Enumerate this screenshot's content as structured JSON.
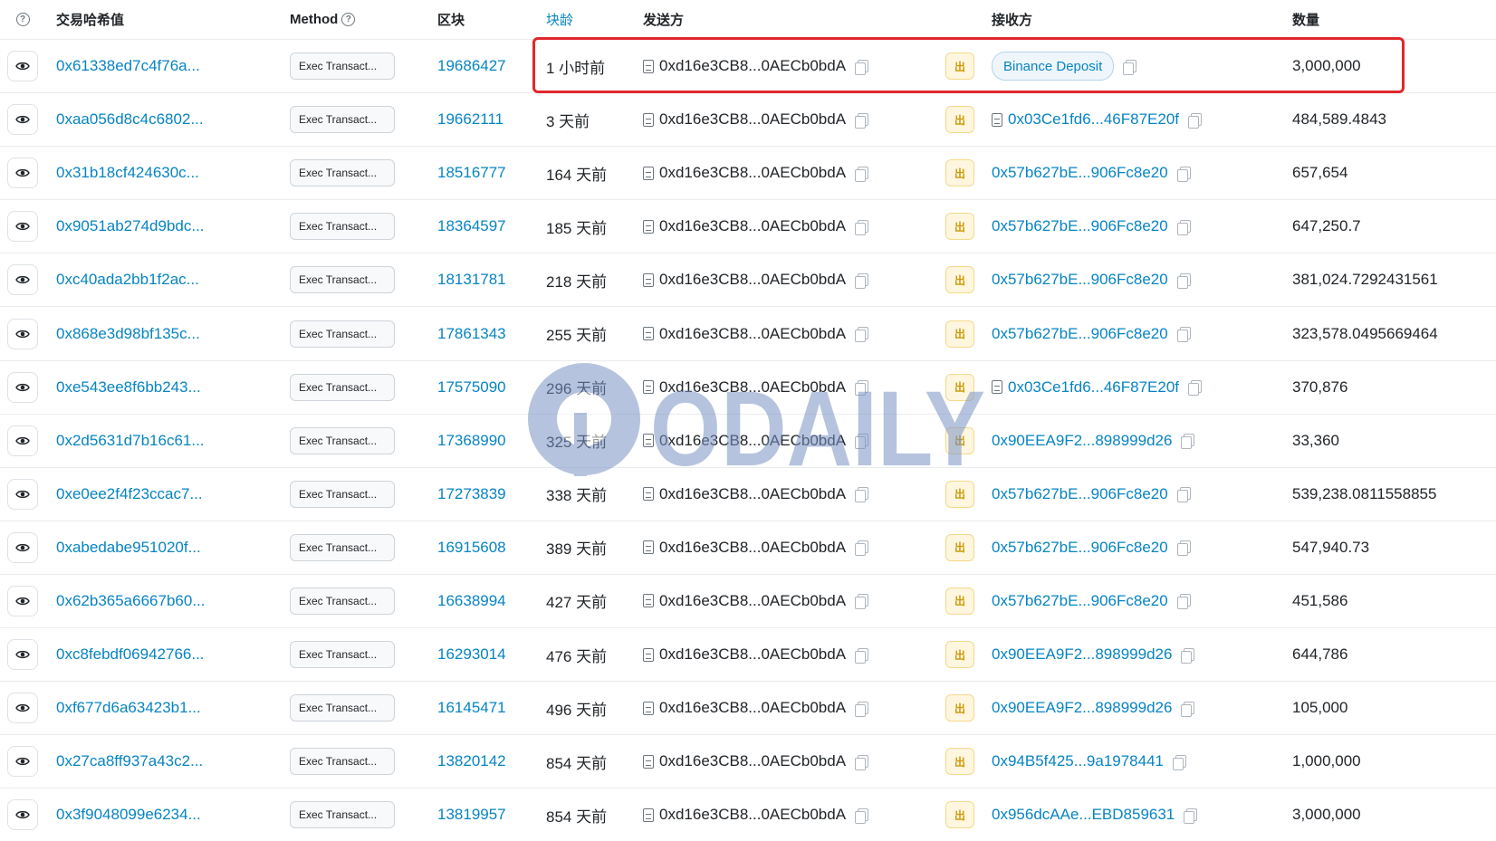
{
  "header": {
    "info_icon": "question-circle-icon",
    "tx_hash": "交易哈希值",
    "method": "Method",
    "block": "区块",
    "age": "块龄",
    "from": "发送方",
    "to": "接收方",
    "amount": "数量"
  },
  "rows": [
    {
      "hash": "0x61338ed7c4f76a...",
      "method": "Exec Transact...",
      "block": "19686427",
      "age": "1 小时前",
      "from": "0xd16e3CB8...0AECb0bdA",
      "direction": "出",
      "to": "Binance Deposit",
      "to_is_label": true,
      "amount": "3,000,000"
    },
    {
      "hash": "0xaa056d8c4c6802...",
      "method": "Exec Transact...",
      "block": "19662111",
      "age": "3 天前",
      "from": "0xd16e3CB8...0AECb0bdA",
      "direction": "出",
      "to": "0x03Ce1fd6...46F87E20f",
      "to_is_contract": true,
      "amount": "484,589.4843"
    },
    {
      "hash": "0x31b18cf424630c...",
      "method": "Exec Transact...",
      "block": "18516777",
      "age": "164 天前",
      "from": "0xd16e3CB8...0AECb0bdA",
      "direction": "出",
      "to": "0x57b627bE...906Fc8e20",
      "amount": "657,654"
    },
    {
      "hash": "0x9051ab274d9bdc...",
      "method": "Exec Transact...",
      "block": "18364597",
      "age": "185 天前",
      "from": "0xd16e3CB8...0AECb0bdA",
      "direction": "出",
      "to": "0x57b627bE...906Fc8e20",
      "amount": "647,250.7"
    },
    {
      "hash": "0xc40ada2bb1f2ac...",
      "method": "Exec Transact...",
      "block": "18131781",
      "age": "218 天前",
      "from": "0xd16e3CB8...0AECb0bdA",
      "direction": "出",
      "to": "0x57b627bE...906Fc8e20",
      "amount": "381,024.7292431561"
    },
    {
      "hash": "0x868e3d98bf135c...",
      "method": "Exec Transact...",
      "block": "17861343",
      "age": "255 天前",
      "from": "0xd16e3CB8...0AECb0bdA",
      "direction": "出",
      "to": "0x57b627bE...906Fc8e20",
      "amount": "323,578.0495669464"
    },
    {
      "hash": "0xe543ee8f6bb243...",
      "method": "Exec Transact...",
      "block": "17575090",
      "age": "296 天前",
      "from": "0xd16e3CB8...0AECb0bdA",
      "direction": "出",
      "to": "0x03Ce1fd6...46F87E20f",
      "to_is_contract": true,
      "amount": "370,876"
    },
    {
      "hash": "0x2d5631d7b16c61...",
      "method": "Exec Transact...",
      "block": "17368990",
      "age": "325 天前",
      "from": "0xd16e3CB8...0AECb0bdA",
      "direction": "出",
      "to": "0x90EEA9F2...898999d26",
      "amount": "33,360"
    },
    {
      "hash": "0xe0ee2f4f23ccac7...",
      "method": "Exec Transact...",
      "block": "17273839",
      "age": "338 天前",
      "from": "0xd16e3CB8...0AECb0bdA",
      "direction": "出",
      "to": "0x57b627bE...906Fc8e20",
      "amount": "539,238.0811558855"
    },
    {
      "hash": "0xabedabe951020f...",
      "method": "Exec Transact...",
      "block": "16915608",
      "age": "389 天前",
      "from": "0xd16e3CB8...0AECb0bdA",
      "direction": "出",
      "to": "0x57b627bE...906Fc8e20",
      "amount": "547,940.73"
    },
    {
      "hash": "0x62b365a6667b60...",
      "method": "Exec Transact...",
      "block": "16638994",
      "age": "427 天前",
      "from": "0xd16e3CB8...0AECb0bdA",
      "direction": "出",
      "to": "0x57b627bE...906Fc8e20",
      "amount": "451,586"
    },
    {
      "hash": "0xc8febdf06942766...",
      "method": "Exec Transact...",
      "block": "16293014",
      "age": "476 天前",
      "from": "0xd16e3CB8...0AECb0bdA",
      "direction": "出",
      "to": "0x90EEA9F2...898999d26",
      "amount": "644,786"
    },
    {
      "hash": "0xf677d6a63423b1...",
      "method": "Exec Transact...",
      "block": "16145471",
      "age": "496 天前",
      "from": "0xd16e3CB8...0AECb0bdA",
      "direction": "出",
      "to": "0x90EEA9F2...898999d26",
      "amount": "105,000"
    },
    {
      "hash": "0x27ca8ff937a43c2...",
      "method": "Exec Transact...",
      "block": "13820142",
      "age": "854 天前",
      "from": "0xd16e3CB8...0AECb0bdA",
      "direction": "出",
      "to": "0x94B5f425...9a1978441",
      "amount": "1,000,000"
    },
    {
      "hash": "0x3f9048099e6234...",
      "method": "Exec Transact...",
      "block": "13819957",
      "age": "854 天前",
      "from": "0xd16e3CB8...0AECb0bdA",
      "direction": "出",
      "to": "0x956dcAAe...EBD859631",
      "amount": "3,000,000"
    }
  ],
  "watermark": "ODAILY",
  "colors": {
    "link": "#0784c3",
    "highlight": "#e0272c",
    "out_badge": "#cc9a06"
  }
}
